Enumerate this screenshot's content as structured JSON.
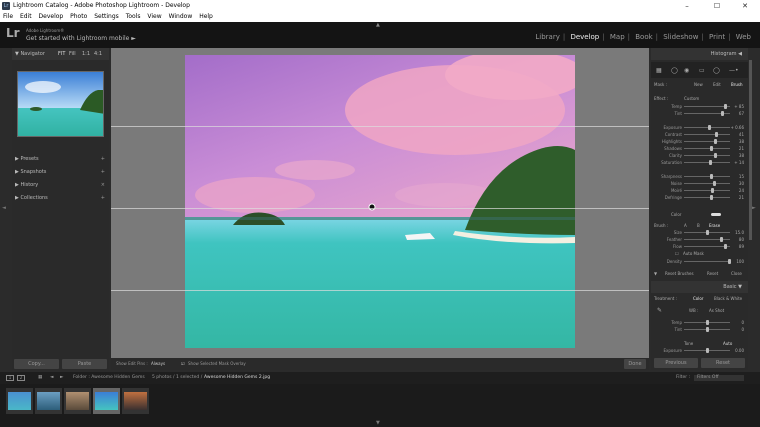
{
  "window": {
    "title": "Lightroom Catalog - Adobe Photoshop Lightroom - Develop",
    "app_icon_label": "Lr",
    "controls": [
      "–",
      "☐",
      "✕"
    ]
  },
  "menu": [
    "File",
    "Edit",
    "Develop",
    "Photo",
    "Settings",
    "Tools",
    "View",
    "Window",
    "Help"
  ],
  "identity": {
    "logo": "Lr",
    "line1": "Adobe Lightroom®",
    "line2": "Get started with Lightroom mobile ►"
  },
  "modules": [
    "Library",
    "Develop",
    "Map",
    "Book",
    "Slideshow",
    "Print",
    "Web"
  ],
  "active_module": "Develop",
  "left_panel": {
    "navigator": {
      "label": "Navigator",
      "zoom_options": [
        "FIT",
        "Fill",
        "1:1",
        "4:1"
      ]
    },
    "sections": [
      "Presets",
      "Snapshots",
      "History",
      "Collections"
    ],
    "copy_label": "Copy...",
    "paste_label": "Paste"
  },
  "toolbar": {
    "show_edit_pins_label": "Show Edit Pins :",
    "show_edit_pins_value": "Always",
    "overlay_label": "Show Selected Mask Overlay",
    "done_label": "Done"
  },
  "right_panel": {
    "histogram_label": "Histogram",
    "mask_label": "Mask :",
    "mask_modes": [
      "New",
      "Edit",
      "Brush"
    ],
    "effect_label": "Effect :",
    "effect_value": "Custom",
    "sliders": [
      {
        "label": "Temp",
        "value": "+ 85",
        "pos": 0.92
      },
      {
        "label": "Tint",
        "value": "67",
        "pos": 0.83
      },
      {
        "label": "Exposure",
        "value": "+ 0.66",
        "pos": 0.55
      },
      {
        "label": "Contrast",
        "value": "41",
        "pos": 0.7
      },
      {
        "label": "Highlights",
        "value": "38",
        "pos": 0.69
      },
      {
        "label": "Shadows",
        "value": "21",
        "pos": 0.6
      },
      {
        "label": "Clarity",
        "value": "38",
        "pos": 0.69
      },
      {
        "label": "Saturation",
        "value": "+ 14",
        "pos": 0.57
      },
      {
        "label": "Sharpness",
        "value": "15",
        "pos": 0.58
      },
      {
        "label": "Noise",
        "value": "30",
        "pos": 0.65
      },
      {
        "label": "Moiré",
        "value": "24",
        "pos": 0.62
      },
      {
        "label": "Defringe",
        "value": "21",
        "pos": 0.6
      }
    ],
    "color_label": "Color",
    "brush": {
      "label": "Brush :",
      "options": [
        "A",
        "B",
        "Erase"
      ],
      "size_label": "Size",
      "size_value": "15.0",
      "feather_label": "Feather",
      "feather_value": "80",
      "flow_label": "Flow",
      "flow_value": "89",
      "automask_label": "Auto Mask",
      "density_label": "Density",
      "density_value": "100"
    },
    "reset_brushes_label": "Reset Brushes",
    "reset_label": "Reset",
    "close_label": "Close",
    "basic_label": "Basic",
    "treatment": [
      "Treatment :",
      "Color",
      "Black & White"
    ],
    "wb_label": "WB :",
    "wb_value": "As Shot",
    "temp_label": "Temp",
    "temp_value": "0",
    "tint_label": "Tint",
    "tint_value": "0",
    "tone_label": "Tone",
    "auto_label": "Auto",
    "exposure_label": "Exposure",
    "exposure_value": "0.00",
    "previous_label": "Previous",
    "reset_btn_label": "Reset"
  },
  "filmstrip_bar": {
    "view_1": "1",
    "view_2": "2",
    "path": "Folder : Awesome Hidden Gems",
    "count": "5 photos / 1 selected /",
    "filename": "Awesome Hidden Gems 2.jpg",
    "filter_label": "Filter :",
    "filter_value": "Filters Off"
  },
  "colors": {
    "sky_top": "#b57dd8",
    "sky_pink": "#eaa0c8",
    "sea": "#42c7b8",
    "accent": "#dddddd"
  }
}
